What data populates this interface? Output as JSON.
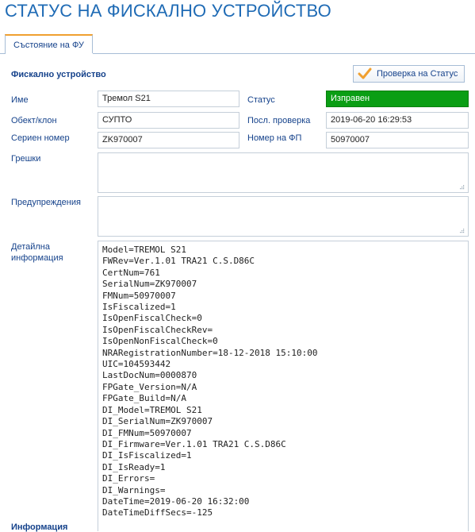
{
  "page": {
    "title": "СТАТУС НА ФИСКАЛНО УСТРОЙСТВО"
  },
  "tabs": [
    {
      "label": "Състояние на ФУ",
      "active": true
    }
  ],
  "section": {
    "title": "Фискално устройство",
    "check_button": {
      "label": "Проверка на Статус",
      "icon": "checkmark-icon"
    }
  },
  "fields": {
    "name": {
      "label": "Име",
      "value": "Тремол S21"
    },
    "status": {
      "label": "Статус",
      "value": "Изправен",
      "color": "#0a9e14"
    },
    "site": {
      "label": "Обект/клон",
      "value": "СУПТО"
    },
    "last_check": {
      "label": "Посл. проверка",
      "value": "2019-06-20 16:29:53"
    },
    "serial": {
      "label": "Сериен номер",
      "value": "ZK970007"
    },
    "fp_number": {
      "label": "Номер на ФП",
      "value": "50970007"
    },
    "errors": {
      "label": "Грешки",
      "value": ""
    },
    "warnings": {
      "label": "Предупреждения",
      "value": ""
    },
    "details": {
      "label_line1": "Детайлна",
      "label_line2": "информация",
      "lines": [
        "Model=TREMOL S21",
        "FWRev=Ver.1.01 TRA21 C.S.D86C",
        "CertNum=761",
        "SerialNum=ZK970007",
        "FMNum=50970007",
        "IsFiscalized=1",
        "IsOpenFiscalCheck=0",
        "IsOpenFiscalCheckRev=",
        "IsOpenNonFiscalCheck=0",
        "NRARegistrationNumber=18-12-2018 15:10:00",
        "UIC=104593442",
        "LastDocNum=0000870",
        "FPGate_Version=N/A",
        "FPGate_Build=N/A",
        "DI_Model=TREMOL S21",
        "DI_SerialNum=ZK970007",
        "DI_FMNum=50970007",
        "DI_Firmware=Ver.1.01 TRA21 C.S.D86C",
        "DI_IsFiscalized=1",
        "DI_IsReady=1",
        "DI_Errors=",
        "DI_Warnings=",
        "DateTime=2019-06-20 16:32:00",
        "DateTimeDiffSecs=-125"
      ]
    }
  },
  "info_section": {
    "title": "Информация"
  },
  "colors": {
    "accent": "#15428b",
    "title": "#1f6bb5",
    "status_ok": "#0a9e14",
    "tab_highlight": "#f0a030"
  }
}
